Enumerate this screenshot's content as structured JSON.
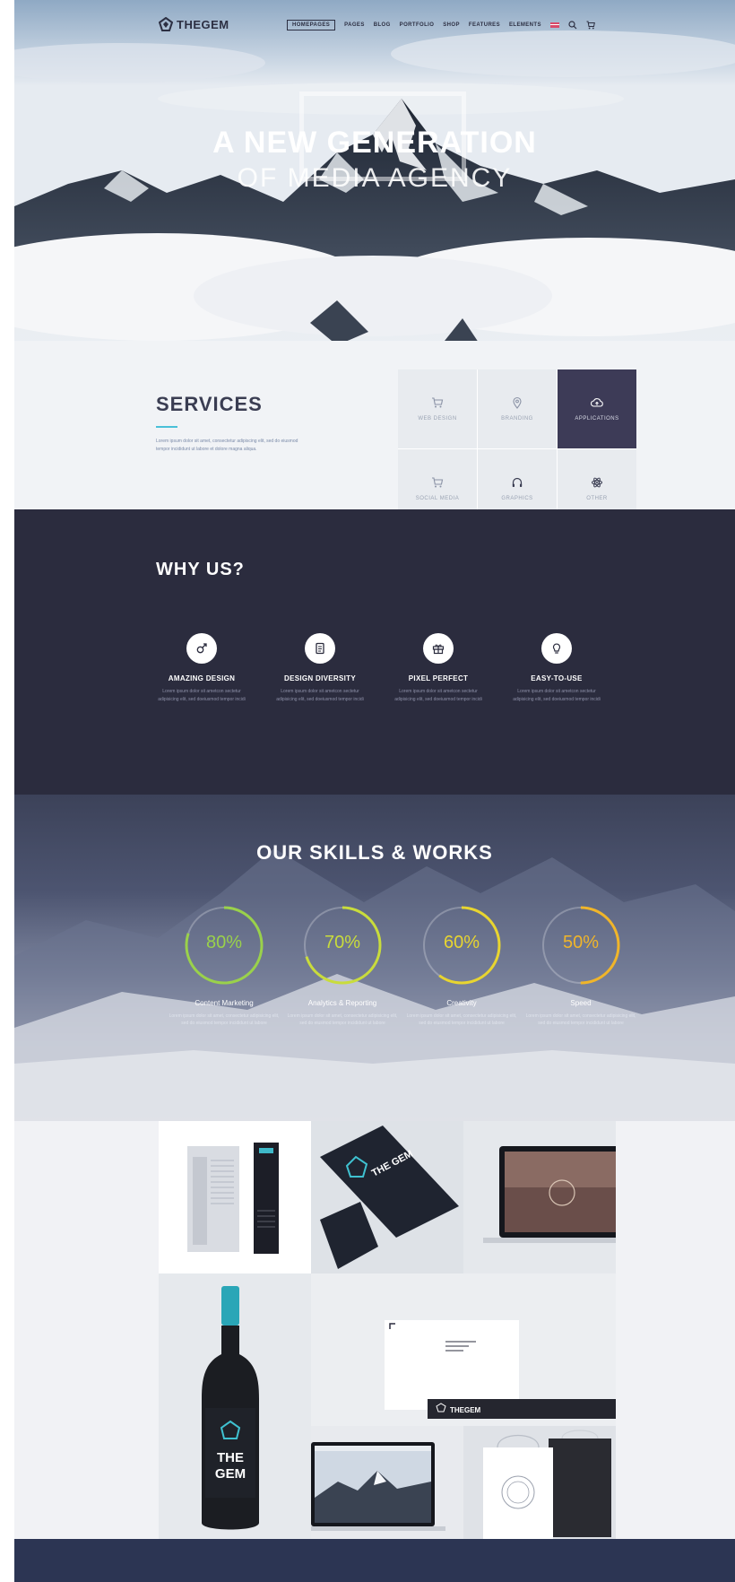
{
  "brand": {
    "name": "THEGEM"
  },
  "nav": {
    "items": [
      {
        "label": "HOMEPAGES",
        "active": true
      },
      {
        "label": "PAGES"
      },
      {
        "label": "BLOG"
      },
      {
        "label": "PORTFOLIO"
      },
      {
        "label": "SHOP"
      },
      {
        "label": "FEATURES"
      },
      {
        "label": "ELEMENTS"
      }
    ],
    "icons": [
      "flag-icon",
      "search-icon",
      "cart-icon"
    ]
  },
  "hero": {
    "title": "A NEW GENERATION",
    "subtitle": "OF MEDIA AGENCY"
  },
  "services": {
    "title": "SERVICES",
    "text": "Lorem ipsum dolor sit amet, consectetur adipiscing elit, sed do eiusmod tempor incididunt ut labore et dolore magna aliqua.",
    "cells": [
      {
        "label": "WEB DESIGN",
        "icon": "cart-icon"
      },
      {
        "label": "BRANDING",
        "icon": "pin-icon"
      },
      {
        "label": "APPLICATIONS",
        "icon": "cloud-upload-icon",
        "active": true
      },
      {
        "label": "SOCIAL MEDIA",
        "icon": "cart-icon"
      },
      {
        "label": "GRAPHICS",
        "icon": "headphones-icon"
      },
      {
        "label": "OTHER",
        "icon": "atom-icon"
      }
    ]
  },
  "why": {
    "title_light": "WHY",
    "title_bold": "US?",
    "features": [
      {
        "title": "AMAZING DESIGN",
        "text": "Lorem ipsum dolor sit ametcon sectetur adipisicing elit, sed doeiusmod tempor incidi",
        "icon": "male-icon"
      },
      {
        "title": "DESIGN DIVERSITY",
        "text": "Lorem ipsum dolor sit ametcon sectetur adipisicing elit, sed doeiusmod tempor incidi",
        "icon": "document-icon"
      },
      {
        "title": "PIXEL PERFECT",
        "text": "Lorem ipsum dolor sit ametcon sectetur adipisicing elit, sed doeiusmod tempor incidi",
        "icon": "gift-icon"
      },
      {
        "title": "EASY-TO-USE",
        "text": "Lorem ipsum dolor sit ametcon sectetur adipisicing elit, sed doeiusmod tempor incidi",
        "icon": "bulb-icon"
      }
    ]
  },
  "skills": {
    "title_light": "OUR SKILLS &",
    "title_bold": "WORKS",
    "items": [
      {
        "percent": "80%",
        "value": 0.8,
        "name": "Content Marketing",
        "text": "Lorem ipsum dolor sit amet, consectetur adipisicing elit, sed do eiusmod tempor incididunt ut labore",
        "color": "#9ad14b"
      },
      {
        "percent": "70%",
        "value": 0.7,
        "name": "Analytics & Reporting",
        "text": "Lorem ipsum dolor sit amet, consectetur adipisicing elit, sed do eiusmod tempor incididunt ut labore",
        "color": "#c9dc3c"
      },
      {
        "percent": "60%",
        "value": 0.6,
        "name": "Creativity",
        "text": "Lorem ipsum dolor sit amet, consectetur adipisicing elit, sed do eiusmod tempor incididunt ut labore",
        "color": "#e8d530"
      },
      {
        "percent": "50%",
        "value": 0.5,
        "name": "Speed",
        "text": "Lorem ipsum dolor sit amet, consectetur adipisicing elit, sed do eiusmod tempor incididunt ut labore",
        "color": "#f0b52a"
      }
    ]
  },
  "portfolio": {
    "bottle_brand_line1": "THE",
    "bottle_brand_line2": "GEM",
    "card_brand": "THE GEM",
    "letterhead_brand": "THEGEM"
  },
  "colors": {
    "dark_navy": "#2b2c3e",
    "accent_purple": "#3d3b57",
    "accent_cyan": "#4ac0d8"
  }
}
